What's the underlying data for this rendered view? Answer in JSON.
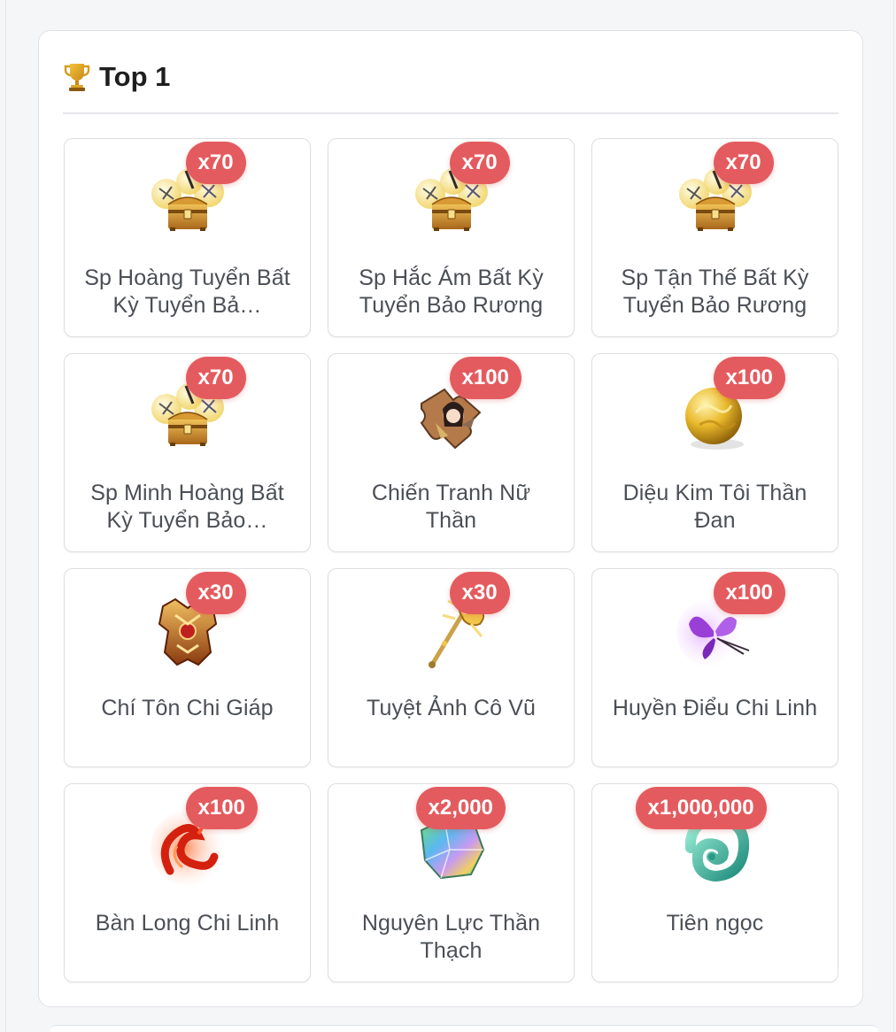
{
  "panel": {
    "title": "Top 1",
    "trophy_icon": "trophy-icon"
  },
  "items": [
    {
      "name": "Sp Hoàng Tuyển Bất Kỳ Tuyển Bảo Rương",
      "display_name": "Sp Hoàng Tuyển Bất Kỳ Tuyển Bả…",
      "qty": "x70",
      "icon": "treasure-chest-icon"
    },
    {
      "name": "Sp Hắc Ám Bất Kỳ Tuyển Bảo Rương",
      "display_name": "Sp Hắc Ám Bất Kỳ Tuyển Bảo Rương",
      "qty": "x70",
      "icon": "treasure-chest-icon"
    },
    {
      "name": "Sp Tận Thế Bất Kỳ Tuyển Bảo Rương",
      "display_name": "Sp Tận Thế Bất Kỳ Tuyển Bảo Rương",
      "qty": "x70",
      "icon": "treasure-chest-icon"
    },
    {
      "name": "Sp Minh Hoàng Bất Kỳ Tuyển Bảo Rương",
      "display_name": "Sp Minh Hoàng Bất Kỳ Tuyển Bảo…",
      "qty": "x70",
      "icon": "treasure-chest-icon"
    },
    {
      "name": "Chiến Tranh Nữ Thần",
      "display_name": "Chiến Tranh Nữ Thần",
      "qty": "x100",
      "icon": "puzzle-piece-icon"
    },
    {
      "name": "Diệu Kim Tôi Thần Đan",
      "display_name": "Diệu Kim Tôi Thần Đan",
      "qty": "x100",
      "icon": "golden-orb-icon"
    },
    {
      "name": "Chí Tôn Chi Giáp",
      "display_name": "Chí Tôn Chi Giáp",
      "qty": "x30",
      "icon": "armor-icon"
    },
    {
      "name": "Tuyệt Ảnh Cô Vũ",
      "display_name": "Tuyệt Ảnh Cô Vũ",
      "qty": "x30",
      "icon": "scepter-icon"
    },
    {
      "name": "Huyền Điểu Chi Linh",
      "display_name": "Huyền Điểu Chi Linh",
      "qty": "x100",
      "icon": "purple-butterfly-icon"
    },
    {
      "name": "Bàn Long Chi Linh",
      "display_name": "Bàn Long Chi Linh",
      "qty": "x100",
      "icon": "red-dragon-icon"
    },
    {
      "name": "Nguyên Lực Thần Thạch",
      "display_name": "Nguyên Lực Thần Thạch",
      "qty": "x2,000",
      "icon": "rainbow-crystal-icon"
    },
    {
      "name": "Tiên ngọc",
      "display_name": "Tiên ngọc",
      "qty": "x1,000,000",
      "icon": "jade-swirl-icon"
    }
  ],
  "colors": {
    "badge": "#e45b5f",
    "panel_border": "#dfe2e6",
    "title": "#1e1e1e",
    "item_text": "#4b4f55"
  }
}
